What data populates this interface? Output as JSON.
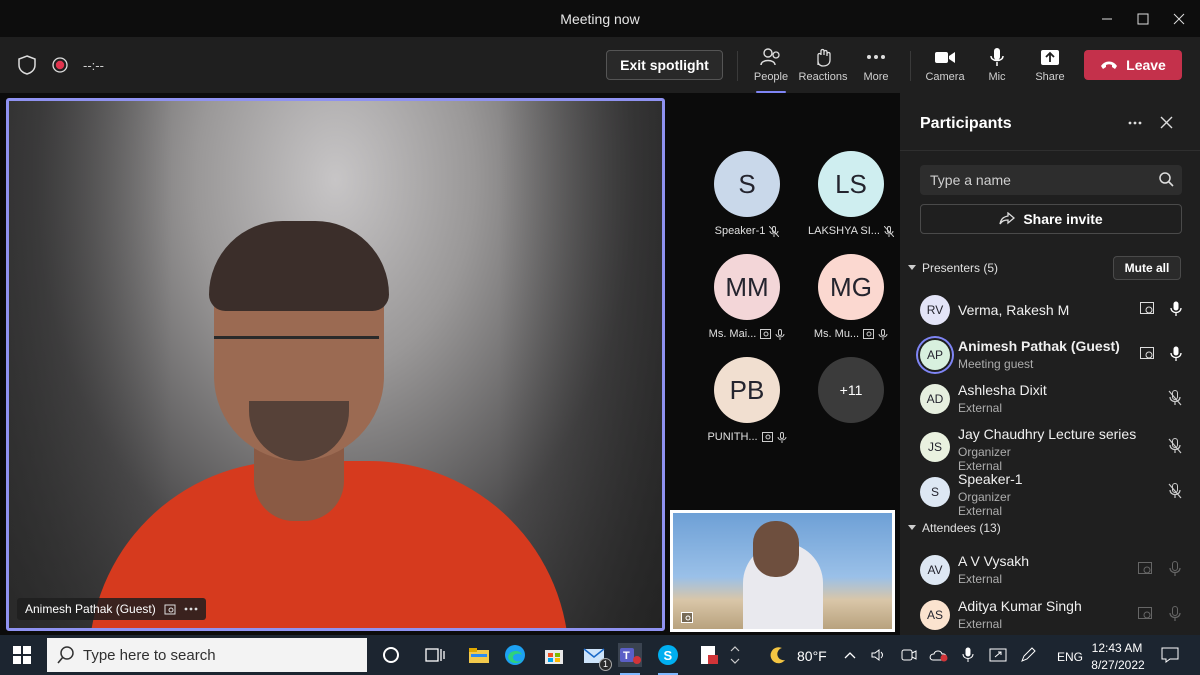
{
  "window": {
    "title": "Meeting now",
    "controls": [
      "minimize",
      "maximize",
      "close"
    ]
  },
  "toolbar": {
    "timer": "--:--",
    "exit_spotlight": "Exit spotlight",
    "buttons": [
      {
        "label": "People",
        "icon": "people-icon"
      },
      {
        "label": "Reactions",
        "icon": "reactions-icon"
      },
      {
        "label": "More",
        "icon": "more-icon"
      },
      {
        "label": "Camera",
        "icon": "camera-icon"
      },
      {
        "label": "Mic",
        "icon": "mic-icon"
      },
      {
        "label": "Share",
        "icon": "share-icon"
      }
    ],
    "leave": "Leave",
    "colors": {
      "accent": "#7f85f5",
      "leave": "#c4314b"
    }
  },
  "stage": {
    "spotlight_name": "Animesh Pathak (Guest)",
    "tiles": [
      {
        "initials": "S",
        "name": "Speaker-1",
        "color": "#c9d8ea"
      },
      {
        "initials": "LS",
        "name": "LAKSHYA SI...",
        "color": "#cfeef0"
      },
      {
        "initials": "MM",
        "name": "Ms. Mai...",
        "color": "#f3d6d8"
      },
      {
        "initials": "MG",
        "name": "Ms. Mu...",
        "color": "#fbd8d0"
      },
      {
        "initials": "PB",
        "name": "PUNITH...",
        "color": "#f1dfd0"
      },
      {
        "initials": "+11",
        "name": "",
        "color": "#3b3b3b"
      }
    ]
  },
  "panel": {
    "title": "Participants",
    "search_placeholder": "Type a name",
    "share_invite": "Share invite",
    "presenters_label": "Presenters (5)",
    "mute_all": "Mute all",
    "attendees_label": "Attendees (13)",
    "presenters": [
      {
        "initials": "RV",
        "name": "Verma, Rakesh M",
        "sub1": "",
        "sub2": "",
        "color": "#e3e4f7",
        "mic": "on"
      },
      {
        "initials": "AP",
        "name": "Animesh Pathak (Guest)",
        "sub1": "Meeting guest",
        "sub2": "",
        "color": "#d8f0de",
        "mic": "on"
      },
      {
        "initials": "AD",
        "name": "Ashlesha Dixit",
        "sub1": "External",
        "sub2": "",
        "color": "#e6efdf",
        "mic": "off"
      },
      {
        "initials": "JS",
        "name": "Jay Chaudhry Lecture series",
        "sub1": "Organizer",
        "sub2": "External",
        "color": "#e9f1df",
        "mic": "off"
      },
      {
        "initials": "S",
        "name": "Speaker-1",
        "sub1": "Organizer",
        "sub2": "External",
        "color": "#dde7f3",
        "mic": "off"
      }
    ],
    "attendees": [
      {
        "initials": "AV",
        "name": "A V Vysakh",
        "sub1": "External",
        "color": "#dde7f3"
      },
      {
        "initials": "AS",
        "name": "Aditya Kumar Singh",
        "sub1": "External",
        "color": "#fbe3cf"
      }
    ]
  },
  "taskbar": {
    "search_placeholder": "Type here to search",
    "weather": "80°F",
    "lang": "ENG",
    "time": "12:43 AM",
    "date": "8/27/2022",
    "mail_badge": "1"
  }
}
